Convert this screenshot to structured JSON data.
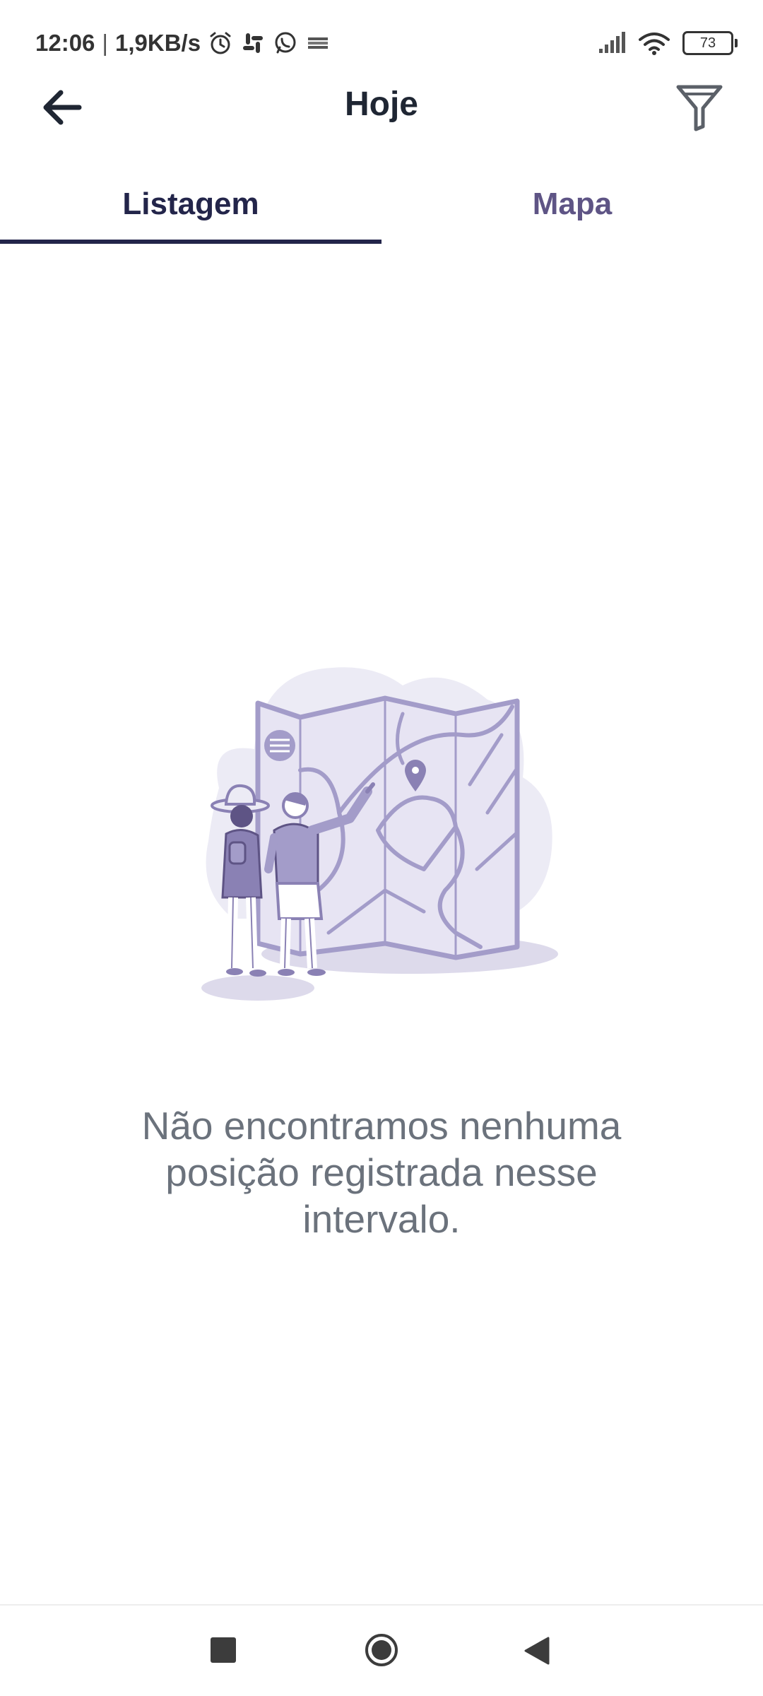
{
  "status_bar": {
    "time": "12:06",
    "separator": "|",
    "speed": "1,9KB/s",
    "icons": [
      "alarm-icon",
      "slack-icon",
      "whatsapp-icon",
      "app-notification-icon"
    ],
    "battery": "73"
  },
  "app_bar": {
    "title": "Hoje",
    "back_icon": "arrow-left-icon",
    "filter_icon": "filter-icon"
  },
  "tabs": [
    {
      "label": "Listagem",
      "active": true
    },
    {
      "label": "Mapa",
      "active": false
    }
  ],
  "empty_state": {
    "illustration": "people-looking-at-map-illustration",
    "message": "Não encontramos nenhuma posição registrada nesse intervalo."
  },
  "nav_bar": {
    "icons": [
      "recents-icon",
      "home-icon",
      "back-triangle-icon"
    ]
  },
  "colors": {
    "tab_active": "#23254a",
    "tab_inactive": "#5e5485",
    "message": "#6b727c",
    "illustration": "#a39cc9"
  }
}
